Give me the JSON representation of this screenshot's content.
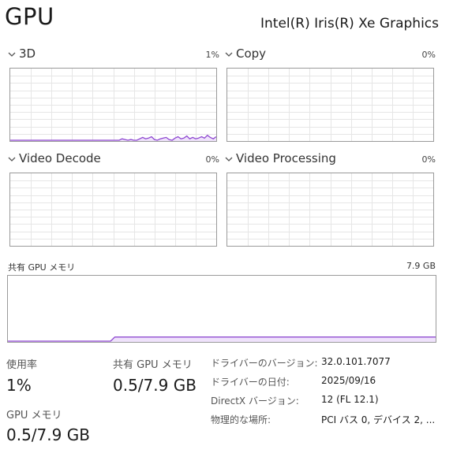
{
  "header": {
    "title": "GPU",
    "gpu_name": "Intel(R) Iris(R) Xe Graphics"
  },
  "panels": [
    {
      "label": "3D",
      "percent": "1%"
    },
    {
      "label": "Copy",
      "percent": "0%"
    },
    {
      "label": "Video Decode",
      "percent": "0%"
    },
    {
      "label": "Video Processing",
      "percent": "0%"
    }
  ],
  "shared_memory": {
    "label": "共有 GPU メモリ",
    "max": "7.9 GB"
  },
  "stats": {
    "usage_label": "使用率",
    "usage_value": "1%",
    "shared_mem_label": "共有 GPU メモリ",
    "shared_mem_value": "0.5/7.9 GB",
    "gpu_mem_label": "GPU メモリ",
    "gpu_mem_value": "0.5/7.9 GB"
  },
  "info": [
    {
      "label": "ドライバーのバージョン:",
      "value": "32.0.101.7077"
    },
    {
      "label": "ドライバーの日付:",
      "value": "2025/09/16"
    },
    {
      "label": "DirectX バージョン:",
      "value": "12 (FL 12.1)"
    },
    {
      "label": "物理的な場所:",
      "value": "PCI バス 0, デバイス 2, ..."
    }
  ],
  "colors": {
    "accent": "#8f49d1",
    "fill": "#efe2fb",
    "grid": "#e6e6e6",
    "border": "#9a9a9a"
  },
  "chart_data": [
    {
      "type": "area",
      "title": "3D",
      "ylim": [
        0,
        100
      ],
      "values": [
        0,
        0,
        0,
        0,
        0,
        0,
        0,
        0,
        0,
        0,
        0,
        0,
        0,
        0,
        0,
        0,
        0,
        0,
        0,
        0,
        0,
        0,
        0,
        0,
        0,
        0,
        0,
        0,
        0,
        0,
        0,
        0,
        0,
        0,
        0,
        0,
        0,
        0,
        2,
        1,
        0,
        1,
        0,
        0,
        2,
        4,
        2,
        3,
        5,
        1,
        0,
        2,
        3,
        4,
        1,
        0,
        3,
        5,
        2,
        3,
        6,
        2,
        4,
        2,
        3,
        5,
        3,
        7,
        4,
        2,
        5
      ]
    },
    {
      "type": "area",
      "title": "Copy",
      "ylim": [
        0,
        100
      ],
      "values": []
    },
    {
      "type": "area",
      "title": "Video Decode",
      "ylim": [
        0,
        100
      ],
      "values": []
    },
    {
      "type": "area",
      "title": "Video Processing",
      "ylim": [
        0,
        100
      ],
      "values": []
    },
    {
      "type": "area",
      "title": "共有 GPU メモリ",
      "ylim": [
        0,
        7.9
      ],
      "values": [
        0,
        0,
        0,
        0,
        0,
        0,
        0,
        0,
        0,
        0,
        0,
        0,
        0,
        0,
        0,
        0,
        0,
        0,
        0,
        0,
        0,
        0,
        0,
        0,
        0,
        0.5,
        0.5,
        0.5,
        0.5,
        0.5,
        0.5,
        0.5,
        0.5,
        0.5,
        0.5,
        0.5,
        0.5,
        0.5,
        0.5,
        0.5,
        0.5,
        0.5,
        0.5,
        0.5,
        0.5,
        0.5,
        0.5,
        0.5,
        0.5,
        0.5,
        0.5,
        0.5,
        0.5,
        0.5,
        0.5,
        0.5,
        0.5,
        0.5,
        0.5,
        0.5,
        0.5,
        0.5,
        0.5,
        0.5,
        0.5,
        0.5,
        0.5,
        0.5,
        0.5,
        0.5,
        0.5,
        0.5,
        0.5,
        0.5,
        0.5,
        0.5,
        0.5,
        0.5,
        0.5,
        0.5,
        0.5,
        0.5,
        0.5,
        0.5,
        0.5,
        0.5,
        0.5,
        0.5,
        0.5,
        0.5,
        0.5,
        0.5,
        0.5,
        0.5,
        0.5,
        0.5,
        0.5,
        0.5,
        0.5,
        0.5,
        0.5
      ]
    }
  ]
}
